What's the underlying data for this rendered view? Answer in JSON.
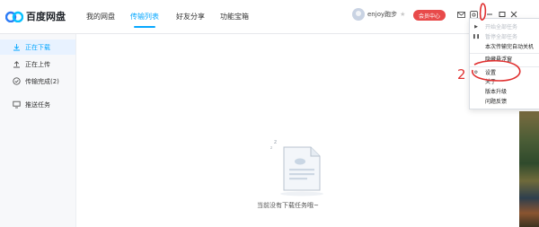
{
  "app": {
    "name": "百度网盘",
    "nav": [
      {
        "label": "我的网盘",
        "active": false
      },
      {
        "label": "传输列表",
        "active": true
      },
      {
        "label": "好友分享",
        "active": false
      },
      {
        "label": "功能宝箱",
        "active": false
      }
    ],
    "user": {
      "name": "enjoy跑步"
    },
    "vip_label": "会员中心",
    "accent_color": "#06a7ff",
    "vip_color": "#e84a4a"
  },
  "sidebar": {
    "items": [
      {
        "label": "正在下载",
        "icon": "download-icon",
        "active": true
      },
      {
        "label": "正在上传",
        "icon": "upload-icon",
        "active": false
      },
      {
        "label": "传输完成(2)",
        "icon": "check-circle-icon",
        "active": false
      },
      {
        "label": "推送任务",
        "icon": "monitor-icon",
        "active": false
      }
    ]
  },
  "main": {
    "empty_text": "当前没有下载任务哦~"
  },
  "menu": {
    "items": [
      {
        "label": "开始全部任务",
        "icon": "play-icon",
        "disabled": true
      },
      {
        "label": "暂停全部任务",
        "icon": "pause-icon",
        "disabled": true
      },
      {
        "label": "本次传输完自动关机",
        "icon": "",
        "disabled": false
      },
      {
        "label": "隐藏悬浮窗",
        "icon": "",
        "disabled": false,
        "separator": true
      },
      {
        "label": "设置",
        "icon": "gear-icon",
        "disabled": false,
        "separator": true
      },
      {
        "label": "关于",
        "icon": "",
        "disabled": false
      },
      {
        "label": "版本升级",
        "icon": "",
        "disabled": false
      },
      {
        "label": "问题反馈",
        "icon": "",
        "disabled": false
      }
    ]
  },
  "annotation": {
    "text": "2",
    "color": "#e03030"
  }
}
